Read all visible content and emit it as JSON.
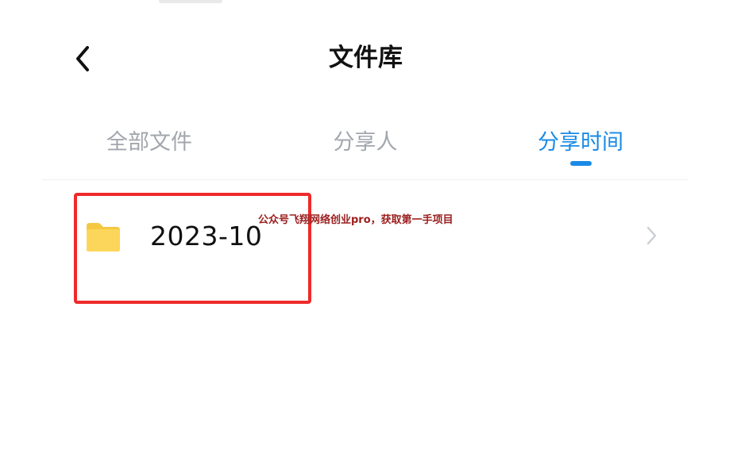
{
  "header": {
    "title": "文件库",
    "back_icon": "chevron-left-icon"
  },
  "tabs": [
    {
      "label": "全部文件",
      "active": false
    },
    {
      "label": "分享人",
      "active": false
    },
    {
      "label": "分享时间",
      "active": true
    }
  ],
  "colors": {
    "accent": "#1a8ae6",
    "inactive_tab": "#a2a6ad",
    "folder": "#fcd65a",
    "annotation": "#ee2a2a",
    "watermark": "#9b1d1d"
  },
  "folders": [
    {
      "name": "2023-10",
      "icon": "folder-icon",
      "trailing_icon": "chevron-right-icon"
    }
  ],
  "overlay": {
    "watermark": "公众号飞翔网络创业pro，获取第一手项目"
  }
}
